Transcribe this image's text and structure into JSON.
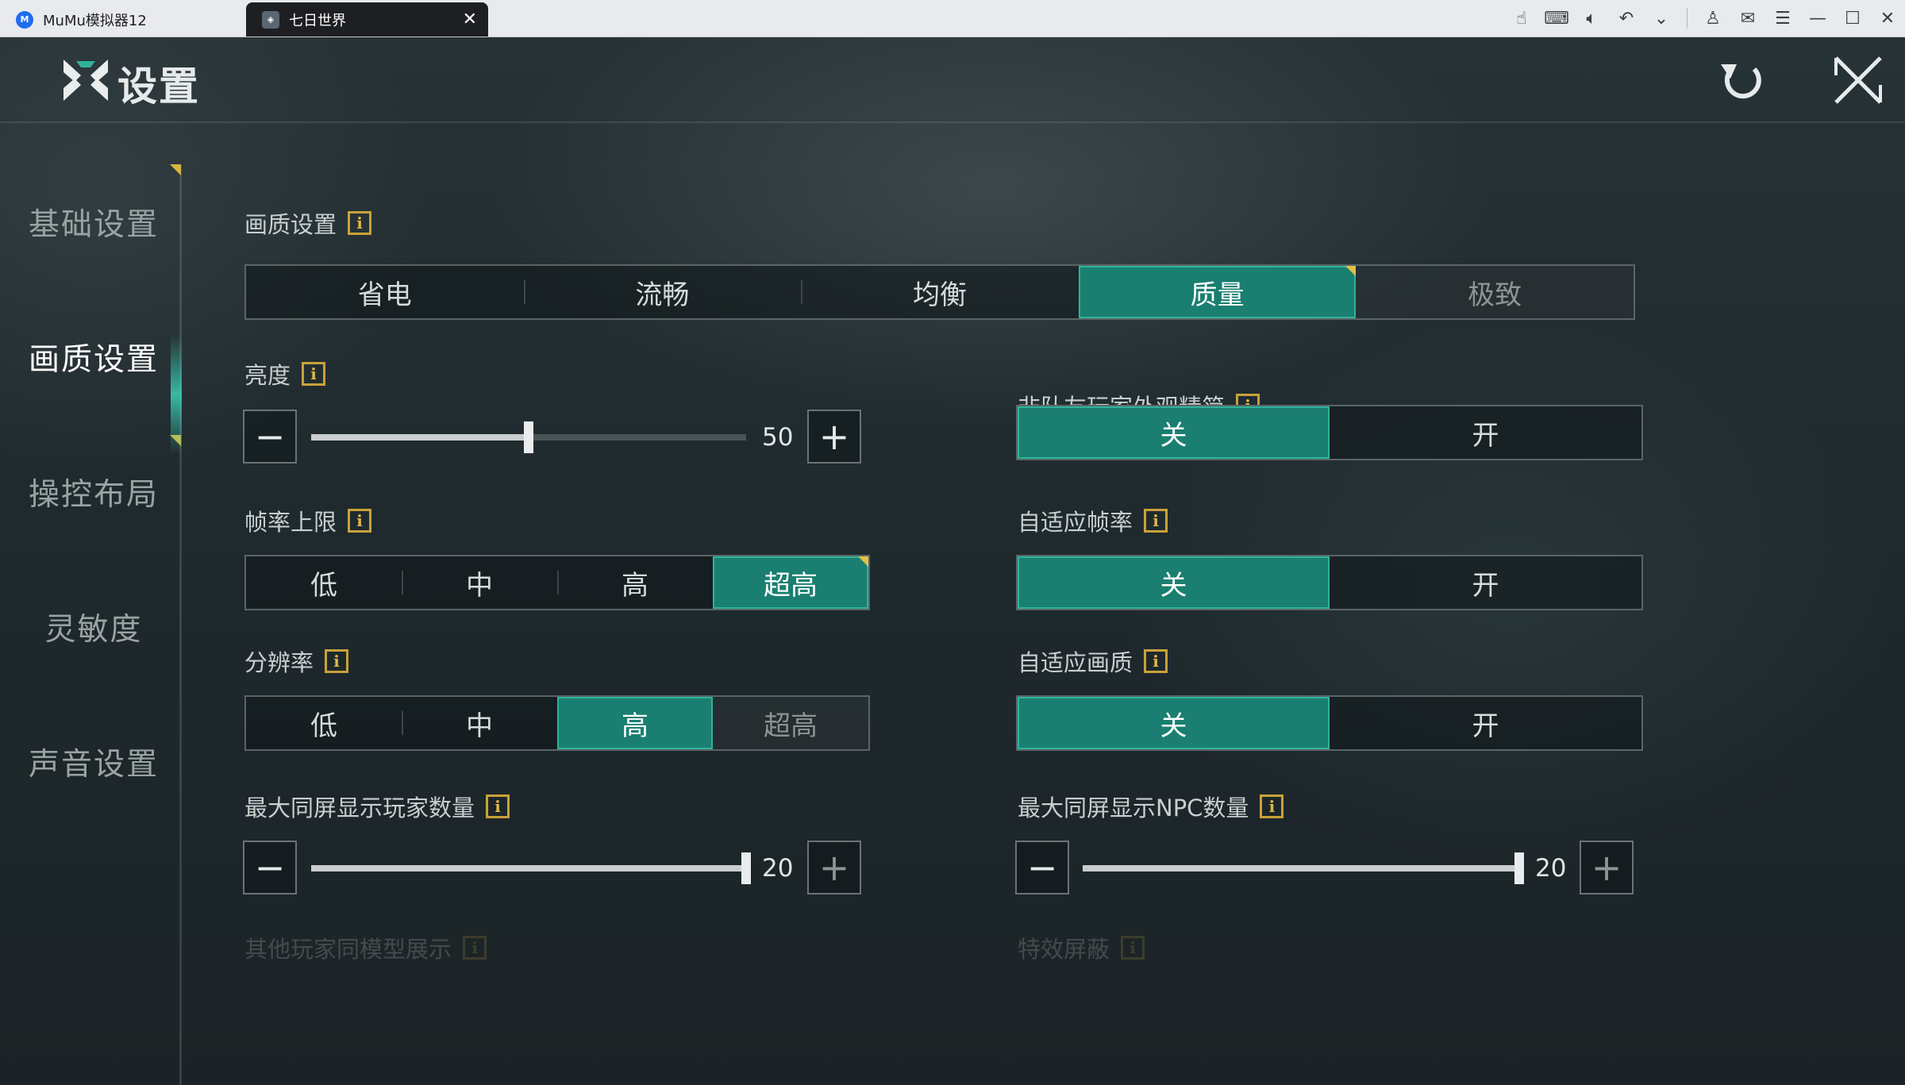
{
  "emulator": {
    "tabs": [
      {
        "label": "MuMu模拟器12",
        "icon": "mumu-logo-icon",
        "active": false
      },
      {
        "label": "七日世界",
        "icon": "game-icon",
        "active": true
      }
    ],
    "toolbar_icons": [
      "touch-icon",
      "keyboard-icon",
      "volume-icon",
      "back-icon",
      "more-icon",
      "account-icon",
      "mail-icon",
      "menu-icon",
      "minimize-icon",
      "maximize-icon",
      "close-icon"
    ]
  },
  "header": {
    "title": "设置"
  },
  "sidebar": {
    "items": [
      {
        "label": "基础设置",
        "active": false
      },
      {
        "label": "画质设置",
        "active": true
      },
      {
        "label": "操控布局",
        "active": false
      },
      {
        "label": "灵敏度",
        "active": false
      },
      {
        "label": "声音设置",
        "active": false
      }
    ]
  },
  "quality": {
    "label": "画质设置",
    "options": [
      "省电",
      "流畅",
      "均衡",
      "质量",
      "极致"
    ],
    "selected": "质量"
  },
  "brightness": {
    "label": "亮度",
    "value": "50",
    "fraction": 0.5
  },
  "fps_limit": {
    "label": "帧率上限",
    "options": [
      "低",
      "中",
      "高",
      "超高"
    ],
    "selected": "超高"
  },
  "resolution": {
    "label": "分辨率",
    "options": [
      "低",
      "中",
      "高",
      "超高"
    ],
    "selected": "高"
  },
  "max_players": {
    "label": "最大同屏显示玩家数量",
    "value": "20",
    "fraction": 1.0
  },
  "simplify_players": {
    "label": "非队友玩家外观精简",
    "off": "关",
    "on": "开",
    "selected": "关"
  },
  "adaptive_fps": {
    "label": "自适应帧率",
    "off": "关",
    "on": "开",
    "selected": "关"
  },
  "adaptive_quality": {
    "label": "自适应画质",
    "off": "关",
    "on": "开",
    "selected": "关"
  },
  "max_npc": {
    "label": "最大同屏显示NPC数量",
    "value": "20",
    "fraction": 1.0
  },
  "faded_labels": {
    "left": "其他玩家同模型展示",
    "right": "特效屏蔽"
  },
  "colors": {
    "accent": "#1a7f70",
    "accent_border": "#2fb39c",
    "info_gold": "#c9a23a"
  }
}
